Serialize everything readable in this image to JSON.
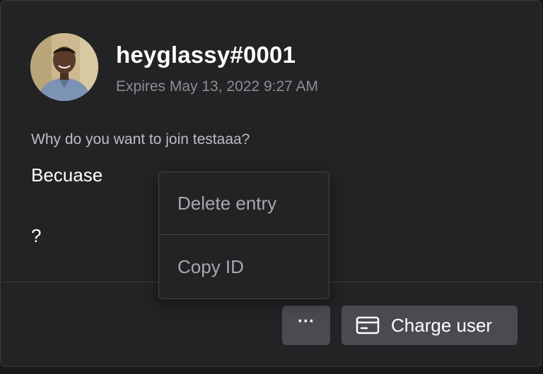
{
  "user": {
    "username": "heyglassy#0001",
    "expires": "Expires May 13, 2022 9:27 AM"
  },
  "application": {
    "question": "Why do you want to join testaaa?",
    "answer_lines": [
      "Becuase",
      "?"
    ]
  },
  "context_menu": {
    "items": [
      {
        "label": "Delete entry"
      },
      {
        "label": "Copy ID"
      }
    ]
  },
  "actions": {
    "more_label": "···",
    "charge_label": "Charge user"
  },
  "icons": {
    "avatar": "user-avatar-photo",
    "charge": "credit-card-icon",
    "more": "ellipsis-icon"
  },
  "colors": {
    "background": "#232326",
    "button": "#4a4a50",
    "muted_text": "#8e8e93"
  }
}
